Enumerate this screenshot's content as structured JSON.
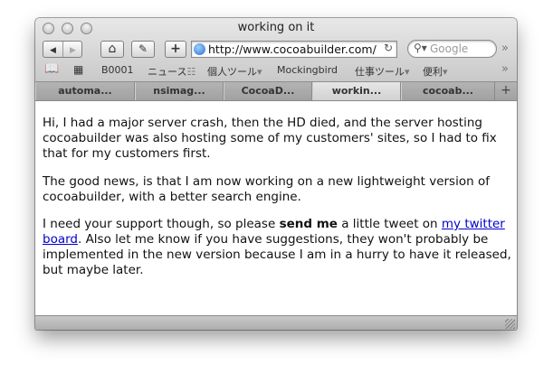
{
  "window": {
    "title": "working on it"
  },
  "toolbar": {
    "back_icon": "◀",
    "forward_icon": "▶",
    "home_icon": "⌂",
    "edit_icon": "✎",
    "add_icon": "+",
    "url": "http://www.cocoabuilder.com/",
    "reload_icon": "↻",
    "search_placeholder": "Google",
    "overflow_icon": "»"
  },
  "bookmarks": {
    "items": [
      {
        "label": "B0001"
      },
      {
        "label": "ニュース"
      },
      {
        "label": "個人ツール"
      },
      {
        "label": "Mockingbird"
      },
      {
        "label": "仕事ツール"
      },
      {
        "label": "便利"
      }
    ],
    "overflow_icon": "»"
  },
  "tabs": [
    {
      "label": "automa..."
    },
    {
      "label": "nsimag..."
    },
    {
      "label": "CocoaD..."
    },
    {
      "label": "workin..."
    },
    {
      "label": "cocoab..."
    }
  ],
  "tab_add": "+",
  "content": {
    "p1": "Hi, I had a major server crash, then the HD died, and the server hosting cocoabuilder was also hosting some of my customers' sites, so I had to fix that for my customers first.",
    "p2": "The good news, is that I am now working on a new lightweight version of cocoabuilder, with a better search engine.",
    "p3_a": "I need your support though, so please ",
    "p3_bold": "send me",
    "p3_b": " a little tweet on ",
    "p3_link": "my twitter board",
    "p3_c": ". Also let me know if you have suggestions, they won't probably be implemented in the new version because I am in a hurry to have it released, but maybe later."
  }
}
